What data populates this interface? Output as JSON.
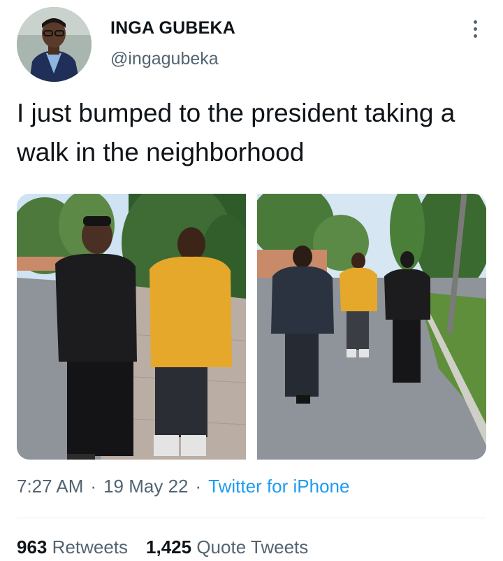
{
  "author": {
    "name": "INGA GUBEKA",
    "handle": "@ingagubeka"
  },
  "tweet": {
    "text": "I just bumped to the president taking a walk in the neighborhood",
    "time": "7:27 AM",
    "date": "19 May 22",
    "separator": "·",
    "source": "Twitter for iPhone"
  },
  "media": {
    "count": 2,
    "colors": {
      "sky": "#cfe3f2",
      "trees": "#3f6b34",
      "yellow_jacket": "#e5a82a",
      "black_outfit": "#1c1c1e",
      "suit": "#2b3240",
      "road": "#8f939a",
      "grass": "#5f8f3a"
    }
  },
  "stats": [
    {
      "num": "963",
      "label": "Retweets"
    },
    {
      "num": "1,425",
      "label": "Quote Tweets"
    }
  ],
  "colors": {
    "text": "#0f1419",
    "secondary": "#536471",
    "link": "#1d9bf0"
  }
}
